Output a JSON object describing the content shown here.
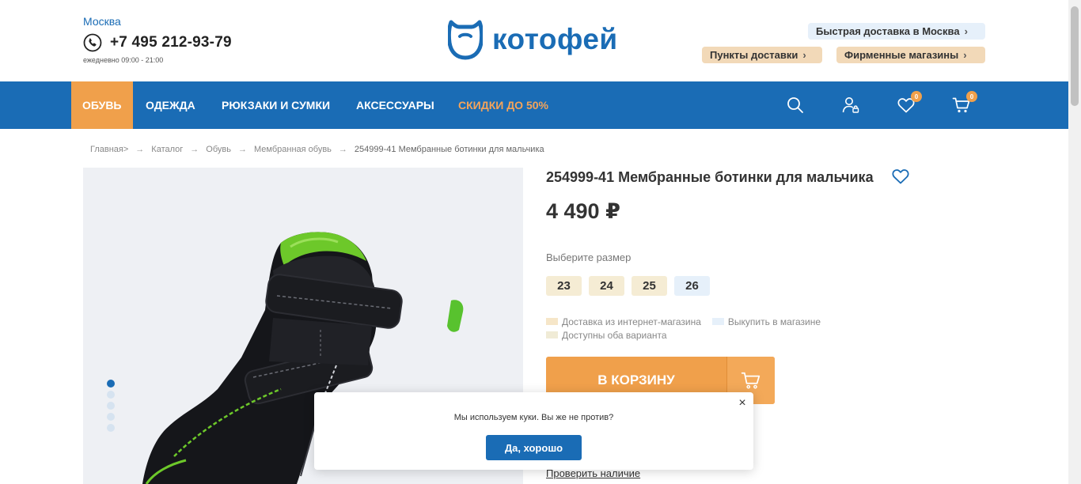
{
  "header": {
    "city": "Москва",
    "phone": "+7 495 212-93-79",
    "hours": "ежедневно 09:00 - 21:00",
    "logo_text": "котофей",
    "fast_delivery": "Быстрая доставка в Москва",
    "pickup_points": "Пункты доставки",
    "brand_stores": "Фирменные магазины"
  },
  "nav": {
    "items": [
      {
        "label": "ОБУВЬ"
      },
      {
        "label": "ОДЕЖДА"
      },
      {
        "label": "РЮКЗАКИ И СУМКИ"
      },
      {
        "label": "АКСЕССУАРЫ"
      },
      {
        "label": "СКИДКИ ДО 50%"
      }
    ],
    "favorites_count": "0",
    "cart_count": "0"
  },
  "breadcrumb": {
    "items": [
      "Главная>",
      "Каталог",
      "Обувь",
      "Мембранная обувь"
    ],
    "current": "254999-41 Мембранные ботинки для мальчика"
  },
  "product": {
    "title": "254999-41 Мембранные ботинки для мальчика",
    "price": "4 490 ₽",
    "size_label": "Выберите размер",
    "sizes": [
      "23",
      "24",
      "25",
      "26"
    ],
    "legend": {
      "delivery": "Доставка из интернет-магазина",
      "shop": "Выкупить в магазине",
      "both": "Доступны оба варианта"
    },
    "add_to_cart": "В КОРЗИНУ",
    "check_availability": "Проверить наличие"
  },
  "cookie": {
    "text": "Мы используем куки. Вы же не против?",
    "accept": "Да, хорошо",
    "close": "×"
  },
  "colors": {
    "brand_blue": "#1a6cb5",
    "accent_orange": "#f0a04b",
    "sale_orange": "#f5a45a"
  }
}
